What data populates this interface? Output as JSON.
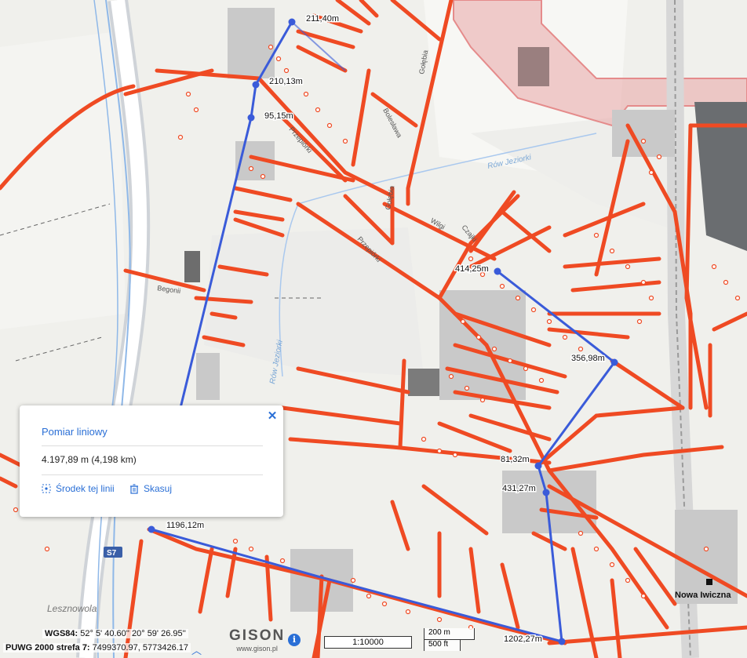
{
  "map": {
    "segment_labels": [
      "211,40m",
      "210,13m",
      "95,15m",
      "414,25m",
      "356,98m",
      "81,32m",
      "431,27m",
      "1196,12m",
      "1202,27m"
    ],
    "street_labels": [
      "Gołębia",
      "Przepiórki",
      "Bolesława",
      "Wilgi",
      "Czajki",
      "Begonii",
      "Gołębia",
      "Przepiórki"
    ],
    "water_labels": [
      "Rów Jeziorki",
      "Rów Jeziorki"
    ],
    "town_label": "Lesznowola",
    "place_label": "Nowa Iwiczna",
    "road_badge": "S7",
    "colors": {
      "network": "#ef4a23",
      "measure": "#3a5bd9",
      "protected": "#e58b8b",
      "water": "#8fb8e8"
    }
  },
  "popup": {
    "title": "Pomiar liniowy",
    "value": "4.197,89 m (4,198 km)",
    "center_label": "Środek tej linii",
    "delete_label": "Skasuj",
    "close_icon": "close-icon"
  },
  "footer": {
    "wgs_label": "WGS84:",
    "wgs_value": "52° 5' 40.60'' 20° 59' 26.95''",
    "puwg_label": "PUWG 2000 strefa 7:",
    "puwg_value": "7499370.97, 5773426.17",
    "logo": "GISON",
    "url": "www.gison.pl",
    "scale": "1:10000",
    "scalebar_m": "200 m",
    "scalebar_ft": "500 ft"
  }
}
